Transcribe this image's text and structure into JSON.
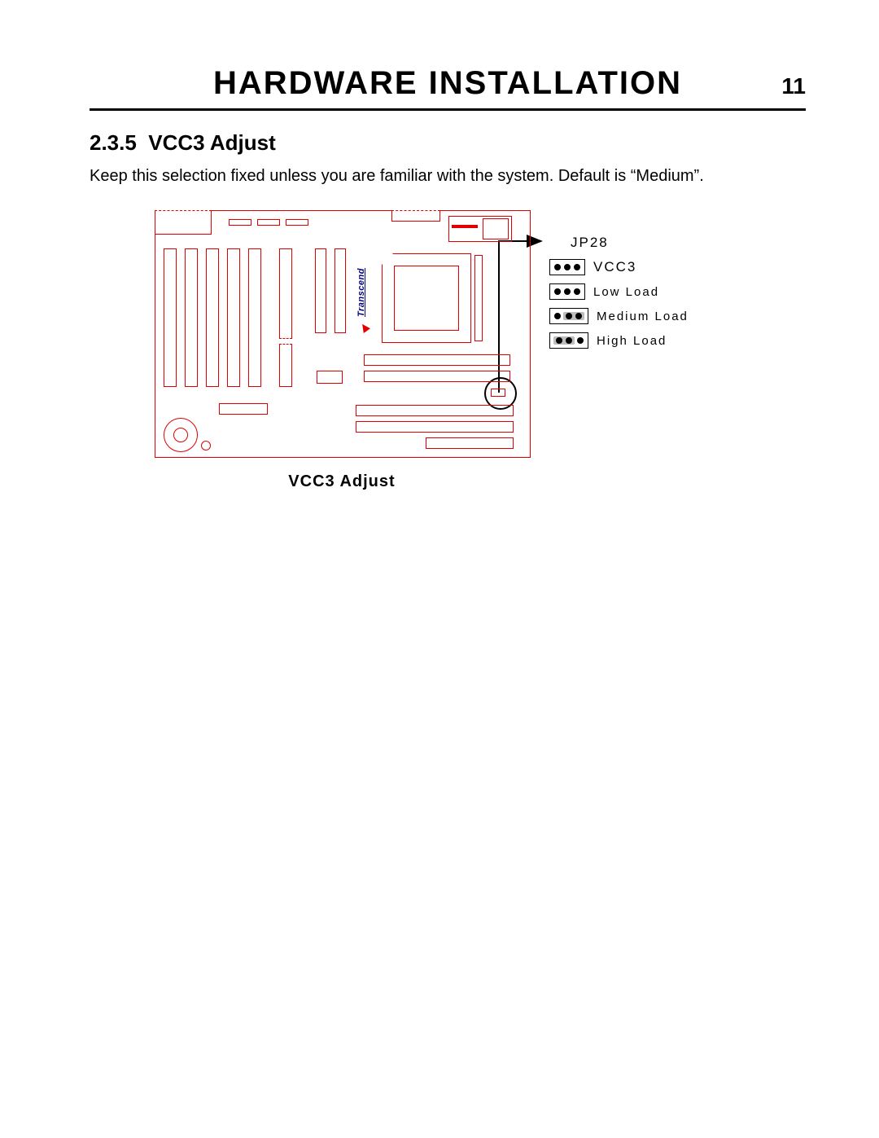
{
  "header": {
    "title": "HARDWARE INSTALLATION",
    "page_number": "11"
  },
  "section": {
    "number": "2.3.5",
    "title": "VCC3 Adjust",
    "body": "Keep this selection fixed unless you are familiar with the system.  Default is “Medium”."
  },
  "diagram": {
    "brand": "Transcend",
    "caption": "VCC3 Adjust"
  },
  "legend": {
    "jumper_ref": "JP28",
    "signal": "VCC3",
    "options": [
      {
        "label": "Low Load",
        "cap_on": "none"
      },
      {
        "label": "Medium Load",
        "cap_on": "2-3"
      },
      {
        "label": "High Load",
        "cap_on": "1-2"
      }
    ]
  }
}
